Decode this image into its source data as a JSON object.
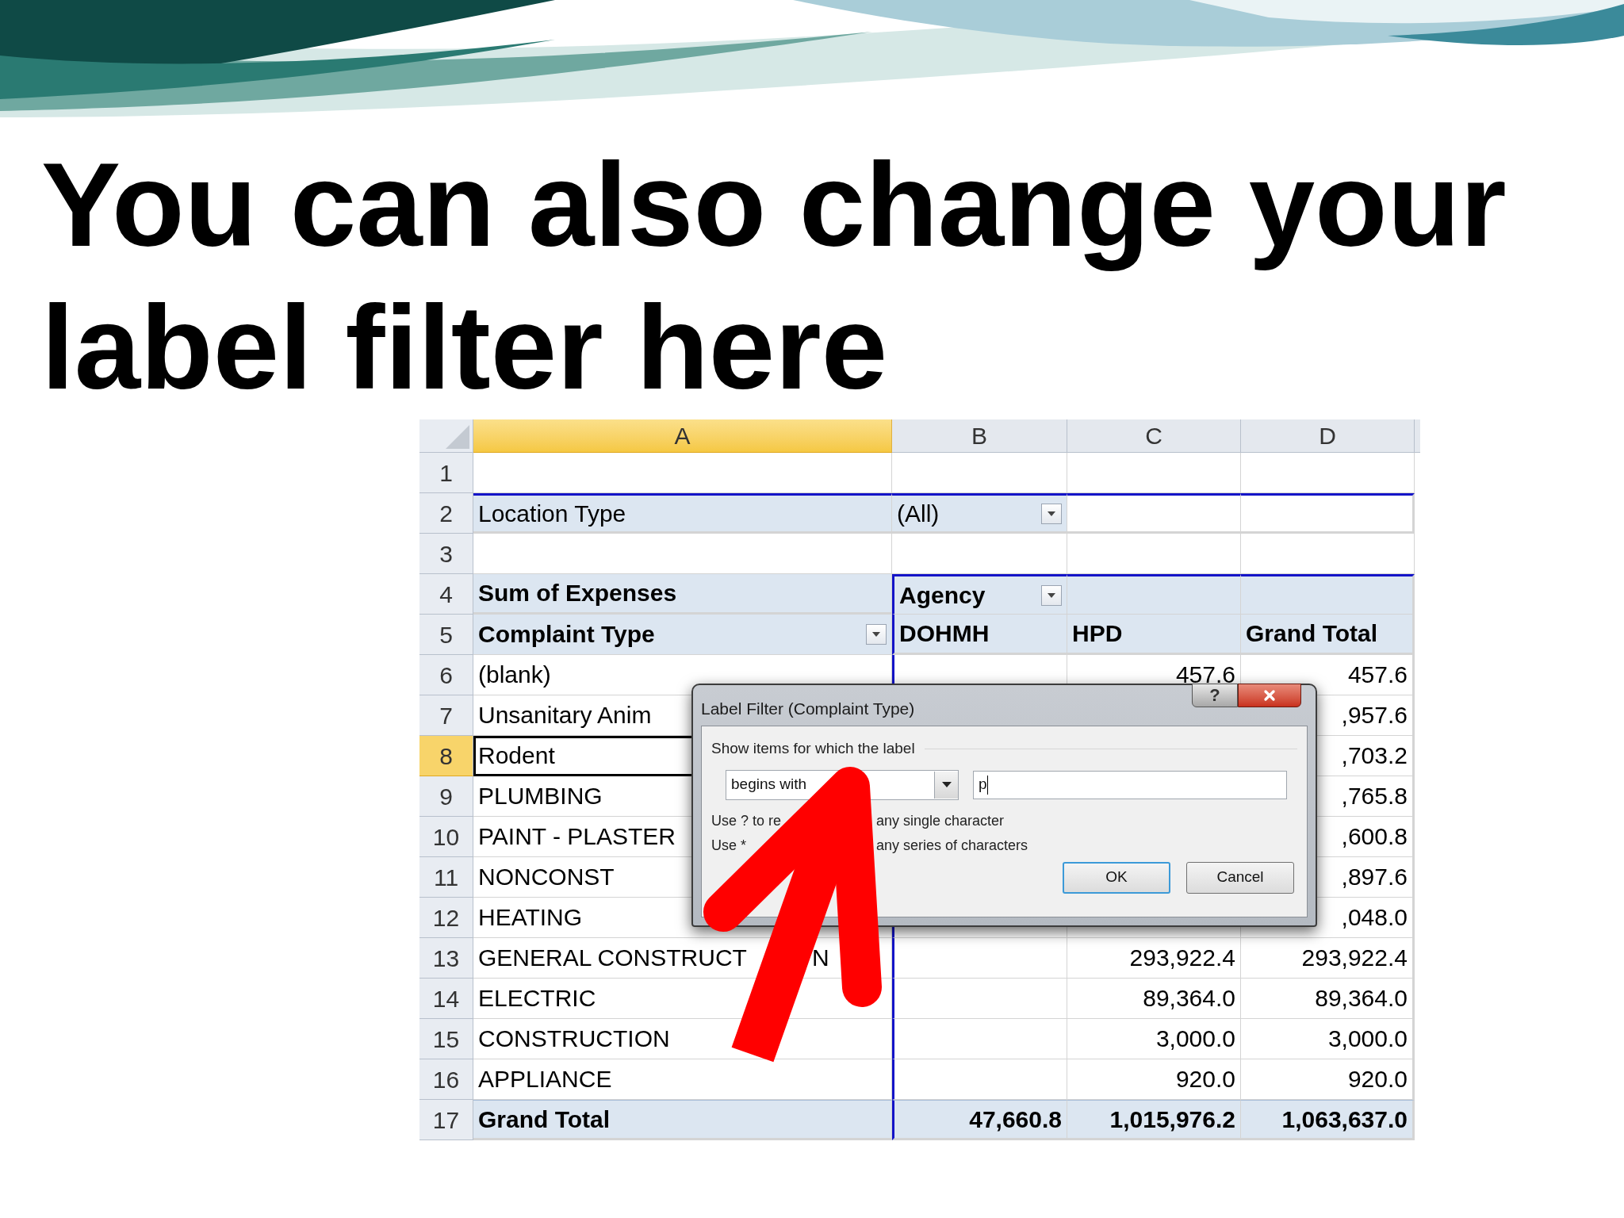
{
  "slide": {
    "title_lines": [
      "You can also change your",
      "label filter here"
    ]
  },
  "sheet": {
    "columns": [
      {
        "label": "A",
        "selected": true
      },
      {
        "label": "B",
        "selected": false
      },
      {
        "label": "C",
        "selected": false
      },
      {
        "label": "D",
        "selected": false
      }
    ],
    "rows": [
      {
        "number": "1",
        "selected": false,
        "kind": "blank"
      },
      {
        "number": "2",
        "selected": false,
        "kind": "page_field",
        "a": "Location Type",
        "b": "(All)"
      },
      {
        "number": "3",
        "selected": false,
        "kind": "blank"
      },
      {
        "number": "4",
        "selected": false,
        "kind": "value_header",
        "a": "Sum of Expenses",
        "b": "Agency"
      },
      {
        "number": "5",
        "selected": false,
        "kind": "column_header",
        "a": "Complaint Type",
        "b": "DOHMH",
        "c": "HPD",
        "d": "Grand Total"
      },
      {
        "number": "6",
        "selected": false,
        "kind": "item",
        "a": "(blank)",
        "c": "457.6",
        "d": "457.6"
      },
      {
        "number": "7",
        "selected": false,
        "kind": "item",
        "a": "Unsanitary Anim",
        "d": ",957.6"
      },
      {
        "number": "8",
        "selected": true,
        "kind": "item",
        "a": "Rodent",
        "d": ",703.2"
      },
      {
        "number": "9",
        "selected": false,
        "kind": "item",
        "a": "PLUMBING",
        "d": ",765.8"
      },
      {
        "number": "10",
        "selected": false,
        "kind": "item",
        "a": "PAINT - PLASTER",
        "d": ",600.8"
      },
      {
        "number": "11",
        "selected": false,
        "kind": "item",
        "a": "NONCONST",
        "d": ",897.6"
      },
      {
        "number": "12",
        "selected": false,
        "kind": "item",
        "a": "HEATING",
        "d": ",048.0"
      },
      {
        "number": "13",
        "selected": false,
        "kind": "item",
        "a": "GENERAL CONSTRUCT",
        "a_tail": "N",
        "c": "293,922.4",
        "d": "293,922.4"
      },
      {
        "number": "14",
        "selected": false,
        "kind": "item",
        "a": "ELECTRIC",
        "c": "89,364.0",
        "d": "89,364.0"
      },
      {
        "number": "15",
        "selected": false,
        "kind": "item",
        "a": "CONSTRUCTION",
        "c": "3,000.0",
        "d": "3,000.0"
      },
      {
        "number": "16",
        "selected": false,
        "kind": "item",
        "a": "APPLIANCE",
        "c": "920.0",
        "d": "920.0"
      },
      {
        "number": "17",
        "selected": false,
        "kind": "total",
        "a": "Grand Total",
        "b": "47,660.8",
        "c": "1,015,976.2",
        "d": "1,063,637.0"
      }
    ]
  },
  "dialog": {
    "title": "Label Filter (Complaint Type)",
    "help_button": "?",
    "group_label": "Show items for which the label",
    "operator": "begins with",
    "value": "p",
    "hints": [
      {
        "before": "Use ? to re",
        "after": "any single character"
      },
      {
        "before": "Use *",
        "after": "any series of characters"
      }
    ],
    "buttons": [
      {
        "label": "OK",
        "default": true
      },
      {
        "label": "Cancel",
        "default": false
      }
    ]
  }
}
